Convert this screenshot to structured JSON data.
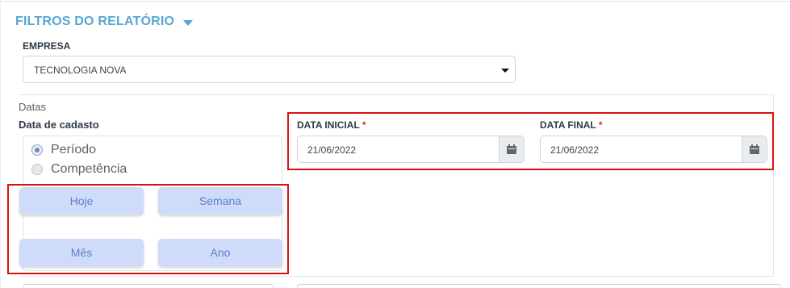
{
  "filters": {
    "title": "FILTROS DO RELATÓRIO",
    "toggle_icon": "caret-down-icon"
  },
  "company": {
    "label": "EMPRESA",
    "value": "TECNOLOGIA NOVA",
    "dropdown_icon": "caret-down-icon"
  },
  "dates": {
    "caption": "Datas",
    "cadastro": {
      "title": "Data de cadasto",
      "options": [
        {
          "label": "Período",
          "checked": true
        },
        {
          "label": "Competência",
          "checked": false
        }
      ]
    },
    "quick_buttons": [
      "Hoje",
      "Semana",
      "Mês",
      "Ano"
    ],
    "start": {
      "label": "DATA INICIAL",
      "required_mark": "*",
      "value": "21/06/2022",
      "icon": "calendar-icon"
    },
    "end": {
      "label": "DATA FINAL",
      "required_mark": "*",
      "value": "21/06/2022",
      "icon": "calendar-icon"
    }
  },
  "colors": {
    "title": "#55a7d6",
    "button_bg": "#cfdcf9",
    "button_text": "#5b80c8",
    "highlight": "#dd1010",
    "required": "#d32f2f"
  }
}
